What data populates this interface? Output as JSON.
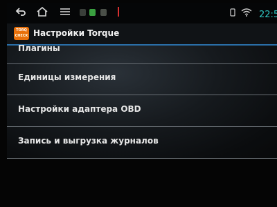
{
  "statusbar": {
    "time": "22:5",
    "back_icon": "back-arrow-icon",
    "home_icon": "home-icon",
    "menu_icon": "menu-icon",
    "wifi_icon": "wifi-icon"
  },
  "appbar": {
    "logo_line1": "TORQ",
    "logo_line2": "CHECK",
    "title": "Настройки Torque"
  },
  "settings": {
    "items": [
      {
        "label": "Плагины"
      },
      {
        "label": "Единицы измерения"
      },
      {
        "label": "Настройки адаптера OBD"
      },
      {
        "label": "Запись и выгрузка журналов"
      }
    ]
  },
  "colors": {
    "accent_line": "#2a6fa8",
    "clock": "#2ec4c0",
    "logo": "#e8700a"
  }
}
